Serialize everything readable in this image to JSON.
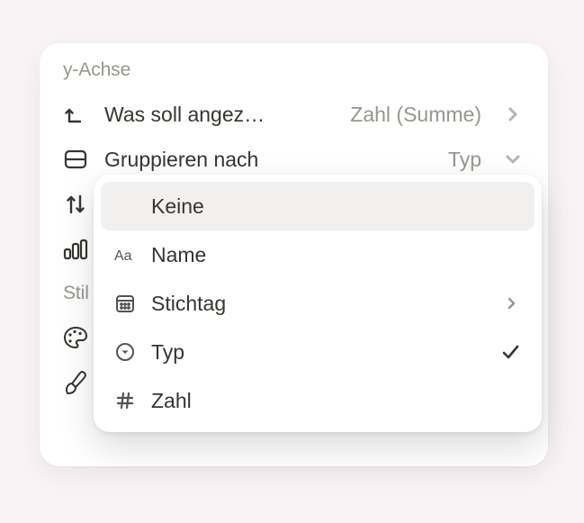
{
  "sections": {
    "yaxis": {
      "header": "y-Achse",
      "rows": {
        "show": {
          "label": "Was soll angez…",
          "value": "Zahl (Summe)"
        },
        "group": {
          "label": "Gruppieren nach",
          "value": "Typ"
        },
        "sort": {
          "label": ""
        },
        "format": {
          "label": ""
        }
      }
    },
    "style": {
      "header": "Stil"
    }
  },
  "dropdown": {
    "items": {
      "none": {
        "label": "Keine"
      },
      "name": {
        "label": "Name"
      },
      "date": {
        "label": "Stichtag"
      },
      "type": {
        "label": "Typ"
      },
      "number": {
        "label": "Zahl"
      }
    }
  }
}
